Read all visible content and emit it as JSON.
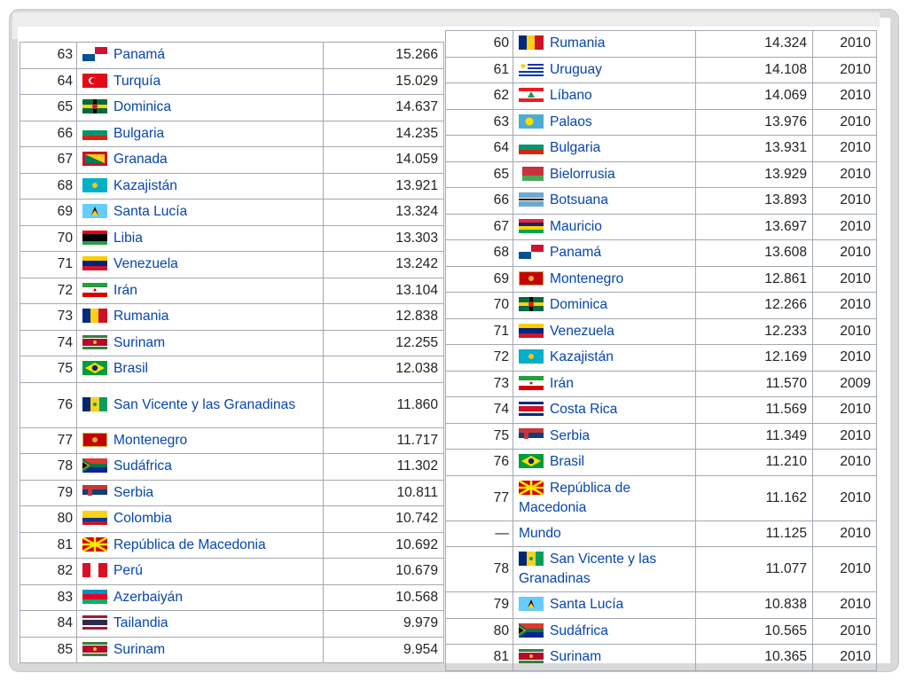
{
  "left_table": {
    "rows": [
      {
        "rank": "63",
        "country": "Panamá",
        "value": "15.266",
        "flag": "panama"
      },
      {
        "rank": "64",
        "country": "Turquía",
        "value": "15.029",
        "flag": "turkey"
      },
      {
        "rank": "65",
        "country": "Dominica",
        "value": "14.637",
        "flag": "dominica"
      },
      {
        "rank": "66",
        "country": "Bulgaria",
        "value": "14.235",
        "flag": "bulgaria"
      },
      {
        "rank": "67",
        "country": "Granada",
        "value": "14.059",
        "flag": "grenada"
      },
      {
        "rank": "68",
        "country": "Kazajistán",
        "value": "13.921",
        "flag": "kazakhstan"
      },
      {
        "rank": "69",
        "country": "Santa Lucía",
        "value": "13.324",
        "flag": "saint-lucia"
      },
      {
        "rank": "70",
        "country": "Libia",
        "value": "13.303",
        "flag": "libya"
      },
      {
        "rank": "71",
        "country": "Venezuela",
        "value": "13.242",
        "flag": "venezuela"
      },
      {
        "rank": "72",
        "country": "Irán",
        "value": "13.104",
        "flag": "iran"
      },
      {
        "rank": "73",
        "country": "Rumania",
        "value": "12.838",
        "flag": "romania"
      },
      {
        "rank": "74",
        "country": "Surinam",
        "value": "12.255",
        "flag": "suriname"
      },
      {
        "rank": "75",
        "country": "Brasil",
        "value": "12.038",
        "flag": "brazil"
      },
      {
        "rank": "76",
        "country": "San Vicente y las Granadinas",
        "value": "11.860",
        "flag": "svg-vincent"
      },
      {
        "rank": "77",
        "country": "Montenegro",
        "value": "11.717",
        "flag": "montenegro"
      },
      {
        "rank": "78",
        "country": "Sudáfrica",
        "value": "11.302",
        "flag": "south-africa"
      },
      {
        "rank": "79",
        "country": "Serbia",
        "value": "10.811",
        "flag": "serbia"
      },
      {
        "rank": "80",
        "country": "Colombia",
        "value": "10.742",
        "flag": "colombia"
      },
      {
        "rank": "81",
        "country": "República de Macedonia",
        "value": "10.692",
        "flag": "macedonia"
      },
      {
        "rank": "82",
        "country": "Perú",
        "value": "10.679",
        "flag": "peru"
      },
      {
        "rank": "83",
        "country": "Azerbaiyán",
        "value": "10.568",
        "flag": "azerbaijan"
      },
      {
        "rank": "84",
        "country": "Tailandia",
        "value": "9.979",
        "flag": "thailand"
      },
      {
        "rank": "85",
        "country": "Surinam",
        "value": "9.954",
        "flag": "suriname"
      }
    ]
  },
  "right_table": {
    "rows": [
      {
        "rank": "60",
        "country": "Rumania",
        "value": "14.324",
        "year": "2010",
        "flag": "romania"
      },
      {
        "rank": "61",
        "country": "Uruguay",
        "value": "14.108",
        "year": "2010",
        "flag": "uruguay"
      },
      {
        "rank": "62",
        "country": "Líbano",
        "value": "14.069",
        "year": "2010",
        "flag": "lebanon"
      },
      {
        "rank": "63",
        "country": "Palaos",
        "value": "13.976",
        "year": "2010",
        "flag": "palau"
      },
      {
        "rank": "64",
        "country": "Bulgaria",
        "value": "13.931",
        "year": "2010",
        "flag": "bulgaria"
      },
      {
        "rank": "65",
        "country": "Bielorrusia",
        "value": "13.929",
        "year": "2010",
        "flag": "belarus"
      },
      {
        "rank": "66",
        "country": "Botsuana",
        "value": "13.893",
        "year": "2010",
        "flag": "botswana"
      },
      {
        "rank": "67",
        "country": "Mauricio",
        "value": "13.697",
        "year": "2010",
        "flag": "mauritius"
      },
      {
        "rank": "68",
        "country": "Panamá",
        "value": "13.608",
        "year": "2010",
        "flag": "panama"
      },
      {
        "rank": "69",
        "country": "Montenegro",
        "value": "12.861",
        "year": "2010",
        "flag": "montenegro"
      },
      {
        "rank": "70",
        "country": "Dominica",
        "value": "12.266",
        "year": "2010",
        "flag": "dominica"
      },
      {
        "rank": "71",
        "country": "Venezuela",
        "value": "12.233",
        "year": "2010",
        "flag": "venezuela"
      },
      {
        "rank": "72",
        "country": "Kazajistán",
        "value": "12.169",
        "year": "2010",
        "flag": "kazakhstan"
      },
      {
        "rank": "73",
        "country": "Irán",
        "value": "11.570",
        "year": "2009",
        "flag": "iran"
      },
      {
        "rank": "74",
        "country": "Costa Rica",
        "value": "11.569",
        "year": "2010",
        "flag": "costa-rica"
      },
      {
        "rank": "75",
        "country": "Serbia",
        "value": "11.349",
        "year": "2010",
        "flag": "serbia"
      },
      {
        "rank": "76",
        "country": "Brasil",
        "value": "11.210",
        "year": "2010",
        "flag": "brazil"
      },
      {
        "rank": "77",
        "country": "República de Macedonia",
        "value": "11.162",
        "year": "2010",
        "flag": "macedonia"
      },
      {
        "rank": "—",
        "country": "Mundo",
        "value": "11.125",
        "year": "2010",
        "flag": ""
      },
      {
        "rank": "78",
        "country": "San Vicente y las Granadinas",
        "value": "11.077",
        "year": "2010",
        "flag": "svg-vincent"
      },
      {
        "rank": "79",
        "country": "Santa Lucía",
        "value": "10.838",
        "year": "2010",
        "flag": "saint-lucia"
      },
      {
        "rank": "80",
        "country": "Sudáfrica",
        "value": "10.565",
        "year": "2010",
        "flag": "south-africa"
      },
      {
        "rank": "81",
        "country": "Surinam",
        "value": "10.365",
        "year": "2010",
        "flag": "suriname"
      }
    ]
  },
  "flag_colors": {
    "panama": [
      "#ffffff",
      "#d21034",
      "#005293"
    ],
    "turkey": [
      "#e30a17"
    ],
    "dominica": [
      "#006b3f",
      "#fcd116",
      "#000000",
      "#d41c30"
    ],
    "bulgaria": [
      "#ffffff",
      "#00966e",
      "#d62612"
    ],
    "grenada": [
      "#ce1126",
      "#fcd116",
      "#007a5e"
    ],
    "kazakhstan": [
      "#00afca",
      "#fec50c"
    ],
    "saint-lucia": [
      "#66ccff",
      "#fcd116",
      "#000000"
    ],
    "libya": [
      "#e70013",
      "#000000",
      "#239e46"
    ],
    "venezuela": [
      "#ffcc00",
      "#00247d",
      "#cf142b"
    ],
    "iran": [
      "#239f40",
      "#ffffff",
      "#da0000"
    ],
    "romania": [
      "#002b7f",
      "#fcd116",
      "#ce1126"
    ],
    "suriname": [
      "#377e3f",
      "#ffffff",
      "#b40a2d"
    ],
    "brazil": [
      "#009c3b",
      "#ffdf00",
      "#002776"
    ],
    "svg-vincent": [
      "#002674",
      "#fcd022",
      "#009e60"
    ],
    "montenegro": [
      "#c40308",
      "#d4af3a"
    ],
    "south-africa": [
      "#007749",
      "#ffb81c",
      "#000000",
      "#de3831",
      "#002395"
    ],
    "serbia": [
      "#c6363c",
      "#0c4076",
      "#ffffff"
    ],
    "colombia": [
      "#fcd116",
      "#003893",
      "#ce1126"
    ],
    "macedonia": [
      "#d20000",
      "#ffe600"
    ],
    "peru": [
      "#d91023",
      "#ffffff"
    ],
    "azerbaijan": [
      "#0092bc",
      "#e4002b",
      "#00af66"
    ],
    "thailand": [
      "#a51931",
      "#f4f5f8",
      "#2d2a4a"
    ],
    "uruguay": [
      "#ffffff",
      "#0038a8",
      "#fcd116"
    ],
    "lebanon": [
      "#ed1c24",
      "#ffffff",
      "#00a651"
    ],
    "palau": [
      "#4aadd6",
      "#ffde00"
    ],
    "belarus": [
      "#c8313e",
      "#4aa657"
    ],
    "botswana": [
      "#6da9d2",
      "#000000",
      "#ffffff"
    ],
    "mauritius": [
      "#ea2839",
      "#1a206d",
      "#ffd500",
      "#00a551"
    ],
    "costa-rica": [
      "#002b7f",
      "#ffffff",
      "#ce1126"
    ]
  }
}
